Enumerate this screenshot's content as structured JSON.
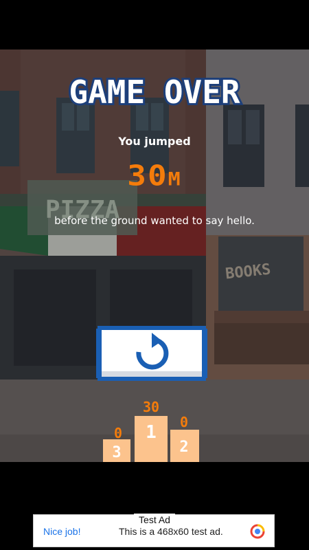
{
  "game": {
    "title": "GAME OVER",
    "jumped_label": "You jumped",
    "distance_value": "30",
    "distance_unit": "M",
    "subtitle": "before the ground wanted to say hello.",
    "retry_icon": "restart-arrow-icon",
    "leaderboard": {
      "first": {
        "rank": "1",
        "score": "30"
      },
      "second": {
        "rank": "2",
        "score": "0"
      },
      "third": {
        "rank": "3",
        "score": "0"
      }
    }
  },
  "background": {
    "shop_signs": [
      "PIZZA",
      "BOOKS"
    ]
  },
  "ad": {
    "label": "Test Ad",
    "left_text": "Nice job!",
    "body_text": "This is a 468x60 test ad.",
    "logo_icon": "admob-logo-icon"
  },
  "colors": {
    "accent_orange": "#f47c0b",
    "button_blue": "#1a5fb4",
    "podium_peach": "#fcc38d"
  }
}
